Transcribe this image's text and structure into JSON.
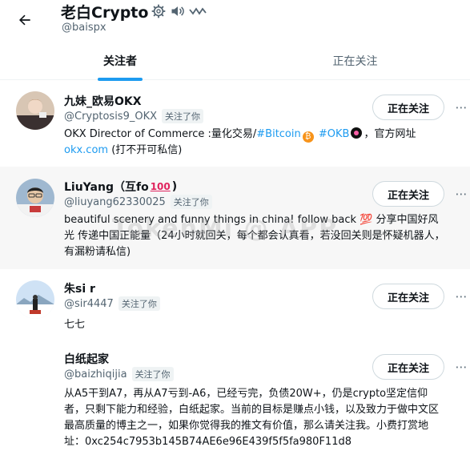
{
  "header": {
    "name": "老白Crypto",
    "handle": "@baispx"
  },
  "tabs": [
    {
      "label": "关注者",
      "active": true
    },
    {
      "label": "正在关注",
      "active": false
    }
  ],
  "users": [
    {
      "name": "九妹_欧易OKX",
      "handle": "@Cryptosis9_OKX",
      "follows_you": "关注了你",
      "bio_pre": "OKX Director of Commerce :量化交易/",
      "tag1": "#Bitcoin",
      "tag2": "#OKB",
      "bio_mid": "，官方网址",
      "link": "okx.com",
      "bio_post": " (打不开可私信)",
      "button": "正在关注"
    },
    {
      "name": "LiuYang（互fo",
      "name_end": ")",
      "handle": "@liuyang62330025",
      "follows_you": "关注了你",
      "bio": "beautiful scenery and funny things in china! follow back 💯 分享中国好风光 传递中国正能量（24小时就回关，每个都会认真看，若没回关则是怀疑机器人，有漏粉请私信)",
      "button": "正在关注"
    },
    {
      "name": "朱si r",
      "handle": "@sir4447",
      "follows_you": "关注了你",
      "bio": "七七",
      "button": "正在关注"
    },
    {
      "name": "白纸起家",
      "handle": "@baizhiqijia",
      "follows_you": "关注了你",
      "bio": "从A5干到A7，再从A7亏到-A6，已经亏完，负债20W+，仍是crypto坚定信仰者，只剩下能力和经验，白纸起家。当前的目标是赚点小钱，以及致力于做中文区最高质量的博主之一，如果你觉得我的推文有价值，那么请关注我。小费打赏地址：0xc254c7953b145B74AE6e96E439f5f5fa980F11d8",
      "button": "正在关注"
    }
  ],
  "watermark": "TokenMi @ APP",
  "colors": {
    "accent": "#1d9bf0",
    "text": "#0f1419",
    "muted": "#536471",
    "bitcoin": "#f7931a"
  }
}
